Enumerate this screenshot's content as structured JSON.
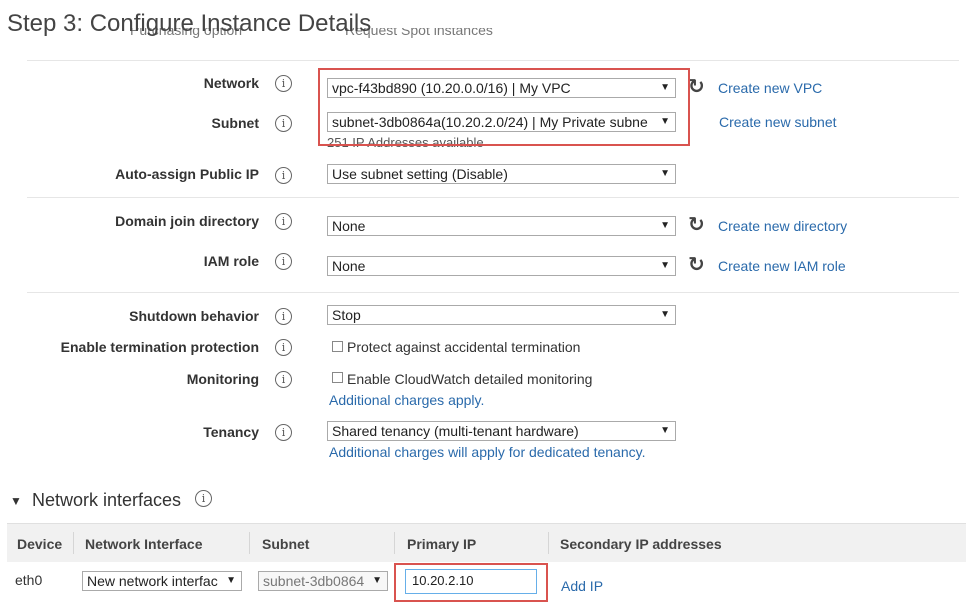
{
  "page": {
    "title": "Step 3: Configure Instance Details",
    "partial_row_text": "Purchasing option",
    "partial_row_value": "Request Spot instances"
  },
  "form": {
    "network": {
      "label": "Network",
      "value": "vpc-f43bd890 (10.20.0.0/16) | My VPC",
      "link": "Create new VPC"
    },
    "subnet": {
      "label": "Subnet",
      "value": "subnet-3db0864a(10.20.2.0/24) | My Private subne",
      "link": "Create new subnet",
      "help": "251 IP Addresses available"
    },
    "public_ip": {
      "label": "Auto-assign Public IP",
      "value": "Use subnet setting (Disable)"
    },
    "domain": {
      "label": "Domain join directory",
      "value": "None",
      "link": "Create new directory"
    },
    "iam": {
      "label": "IAM role",
      "value": "None",
      "link": "Create new IAM role"
    },
    "shutdown": {
      "label": "Shutdown behavior",
      "value": "Stop"
    },
    "termination": {
      "label": "Enable termination protection",
      "checkbox_label": "Protect against accidental termination"
    },
    "monitoring": {
      "label": "Monitoring",
      "checkbox_label": "Enable CloudWatch detailed monitoring",
      "link": "Additional charges apply."
    },
    "tenancy": {
      "label": "Tenancy",
      "value": "Shared tenancy (multi-tenant hardware)",
      "link": "Additional charges will apply for dedicated tenancy."
    }
  },
  "icons": {
    "info": "info-icon",
    "refresh": "refresh-icon",
    "dropdown": "chevron-down-icon",
    "collapse": "caret-down-icon"
  },
  "network_interfaces": {
    "title": "Network interfaces",
    "columns": [
      "Device",
      "Network Interface",
      "Subnet",
      "Primary IP",
      "Secondary IP addresses"
    ],
    "row": {
      "device": "eth0",
      "interface": "New network interfac",
      "subnet": "subnet-3db0864",
      "primary_ip": "10.20.2.10",
      "add_ip": "Add IP"
    }
  },
  "colors": {
    "highlight": "#d9534f",
    "link": "#2a6aab"
  }
}
